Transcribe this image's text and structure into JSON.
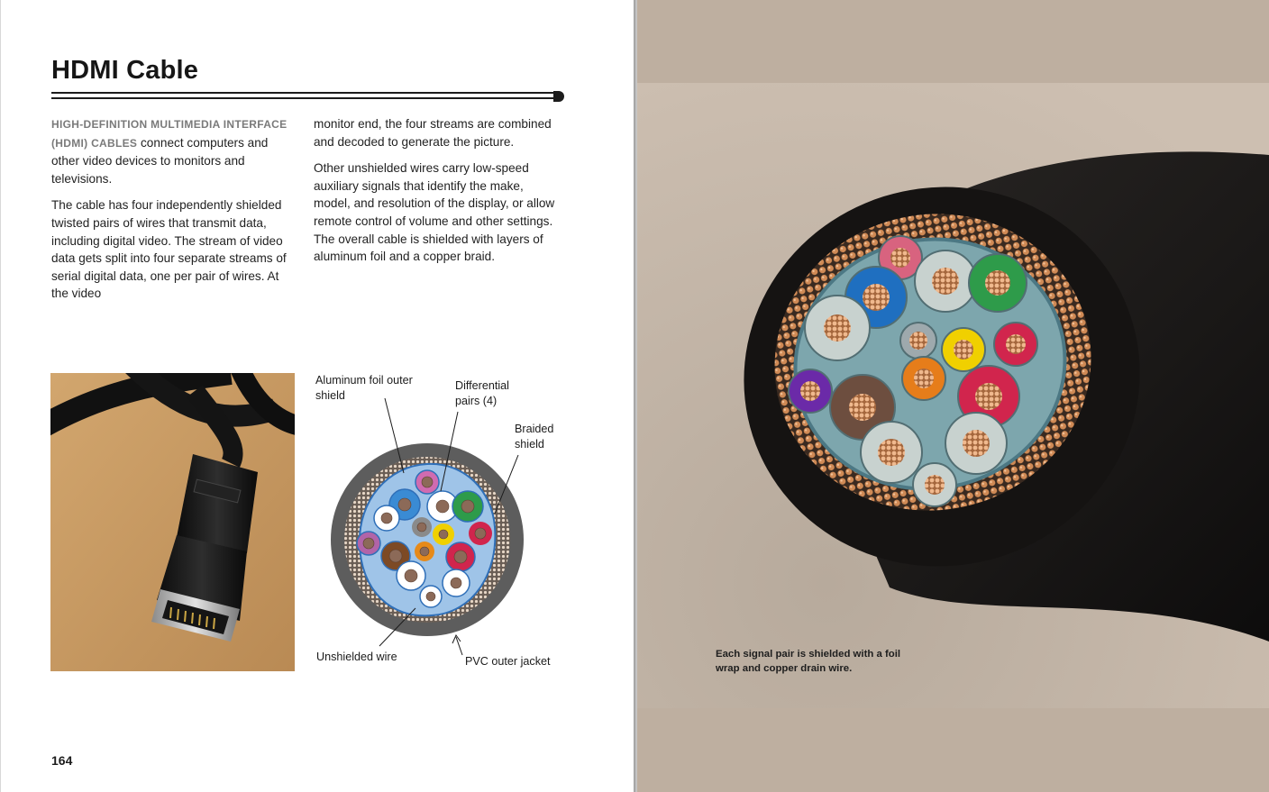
{
  "left_page": {
    "title": "HDMI Cable",
    "column1": {
      "lead": "HIGH-DEFINITION MULTIMEDIA INTERFACE (HDMI) CABLES",
      "p1_rest": " connect computers and other video devices to monitors and televisions.",
      "p2": "The cable has four independently shielded twisted pairs of wires that transmit data, including digital video. The stream of video data gets split into four separate streams of serial digital data, one per pair of wires. At the video"
    },
    "column2": {
      "p1": "monitor end, the four streams are combined and decoded to generate the picture.",
      "p2": "Other unshielded wires carry low-speed auxiliary signals that identify the make, model, and resolution of the display, or allow remote control of volume and other settings. The overall cable is shielded with layers of aluminum foil and a copper braid."
    },
    "diagram_labels": {
      "foil": "Aluminum foil outer shield",
      "pairs": "Differential pairs (4)",
      "braid": "Braided shield",
      "unshielded": "Unshielded wire",
      "jacket": "PVC outer jacket"
    },
    "page_number": "164"
  },
  "right_page": {
    "caption": "Each signal pair is shielded with a foil wrap and copper drain wire."
  },
  "colors": {
    "jacket": "#5d5d5d",
    "foil_blue": "#3a78c8",
    "copper": "#c98a5a",
    "right_bg": "#beafa0",
    "wire_green": "#2e9b4a",
    "wire_blue": "#1d6fc0",
    "wire_red": "#d1254d",
    "wire_yellow": "#f0d000",
    "wire_orange": "#e68a1a",
    "wire_purple": "#7b3fa8",
    "wire_pink": "#d46aa8",
    "wire_brown": "#7d4a25"
  }
}
